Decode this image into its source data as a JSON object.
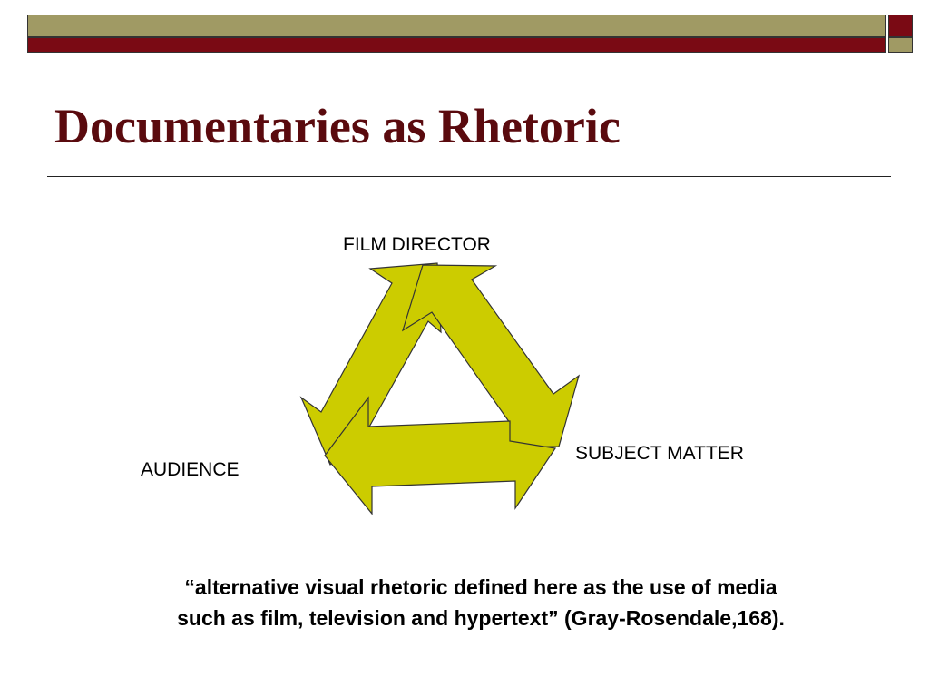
{
  "slide": {
    "title": "Documentaries as Rhetoric",
    "colors": {
      "accent_maroon": "#7a0a14",
      "accent_olive": "#a09a64",
      "title_color": "#5a0a0e",
      "arrow_fill": "#cccc00"
    }
  },
  "diagram": {
    "type": "cycle",
    "nodes": {
      "top": "FILM DIRECTOR",
      "right": "SUBJECT MATTER",
      "left": "AUDIENCE"
    }
  },
  "quote": {
    "line1": "“alternative visual rhetoric defined here as the use of media",
    "line2": "such as film, television and hypertext” (Gray-Rosendale,168)."
  }
}
